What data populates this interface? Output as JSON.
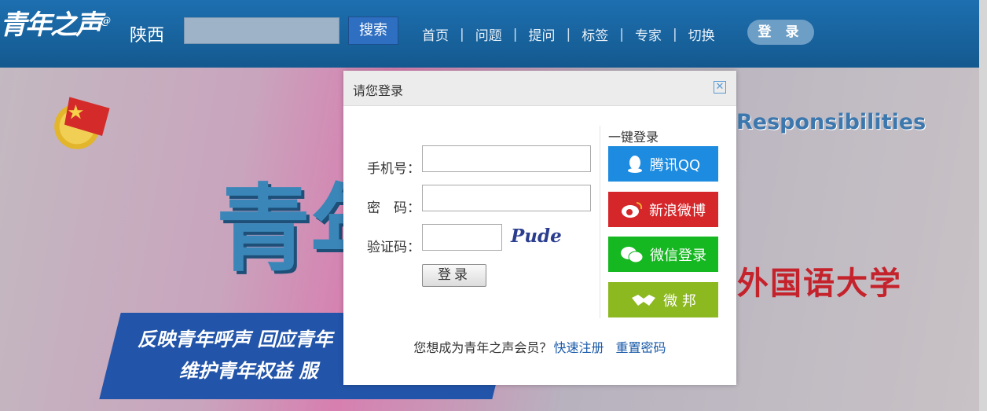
{
  "header": {
    "logo": "青年之声",
    "logo_at": "@",
    "region": "陕西",
    "search_placeholder": "",
    "search_button": "搜索",
    "nav": [
      "首页",
      "问题",
      "提问",
      "标签",
      "专家",
      "切换"
    ],
    "nav_separator": "|",
    "login_button": "登 录"
  },
  "banner": {
    "big_char": "青年",
    "english": "Responsibilities",
    "university": "外国语大学",
    "ribbon_line1": "反映青年呼声  回应青年",
    "ribbon_line2": "维护青年权益  服"
  },
  "login_modal": {
    "title": "请您登录",
    "close_icon": "close-icon",
    "phone_label": "手机号：",
    "password_label": "密　码：",
    "captcha_label": "验证码：",
    "captcha_text": "Pude",
    "submit": "登录",
    "one_click_title": "一键登录",
    "social": [
      {
        "label": "腾讯QQ",
        "icon": "qq-icon",
        "color": "#1c8be0"
      },
      {
        "label": "新浪微博",
        "icon": "weibo-icon",
        "color": "#d5262a"
      },
      {
        "label": "微信登录",
        "icon": "wechat-icon",
        "color": "#15b820"
      },
      {
        "label": "微 邦",
        "icon": "handshake-icon",
        "color": "#8cb820"
      }
    ],
    "footer_prompt": "您想成为青年之声会员？",
    "register_link": "快速注册",
    "reset_link": "重置密码"
  }
}
